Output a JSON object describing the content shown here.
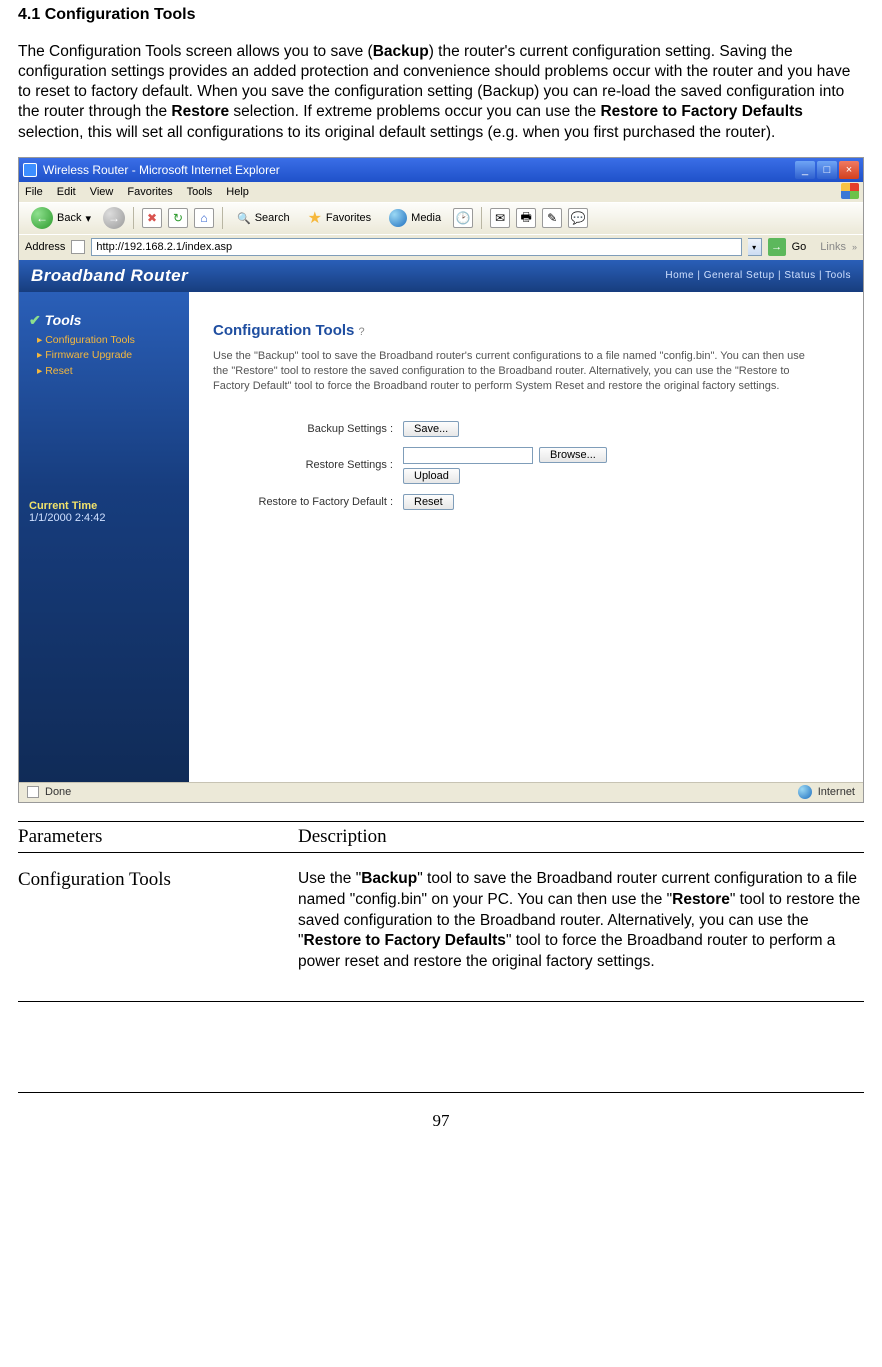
{
  "doc": {
    "section_heading": "4.1 Configuration Tools",
    "intro_pre_backup": "The Configuration Tools screen allows you to save (",
    "intro_backup": "Backup",
    "intro_post_backup": ") the router's current configuration setting. Saving the configuration settings provides an added protection and convenience should problems occur with the router and you have to reset to factory default. When you save the configuration setting (Backup) you can re-load the saved configuration into the router through the ",
    "intro_restore": "Restore",
    "intro_post_restore": " selection. If extreme problems occur you can use the ",
    "intro_r2fd": "Restore to Factory Defaults",
    "intro_post_r2fd": " selection, this will set all configurations to its original default settings (e.g. when you first purchased the router).",
    "page_number": "97"
  },
  "window": {
    "title": "Wireless Router - Microsoft Internet Explorer",
    "menu": {
      "file": "File",
      "edit": "Edit",
      "view": "View",
      "favorites": "Favorites",
      "tools": "Tools",
      "help": "Help"
    },
    "toolbar": {
      "back": "Back",
      "search": "Search",
      "favorites": "Favorites",
      "media": "Media"
    },
    "address_label": "Address",
    "address_value": "http://192.168.2.1/index.asp",
    "go": "Go",
    "links": "Links",
    "status_done": "Done",
    "status_zone": "Internet"
  },
  "router": {
    "brand": "Broadband Router",
    "nav_right": "Home | General Setup | Status | Tools",
    "sidebar": {
      "section": "Tools",
      "items": [
        "Configuration Tools",
        "Firmware Upgrade",
        "Reset"
      ],
      "current_time_label": "Current Time",
      "current_time_value": "1/1/2000 2:4:42"
    },
    "panel": {
      "title": "Configuration Tools",
      "help": "?",
      "desc": "Use the \"Backup\" tool to save the Broadband router's current configurations to a file named \"config.bin\". You can then use the \"Restore\" tool to restore the saved configuration to the Broadband router. Alternatively, you can use the \"Restore to Factory Default\" tool to force the Broadband router to perform System Reset and restore the original factory settings.",
      "rows": {
        "backup_label": "Backup Settings :",
        "backup_button": "Save...",
        "restore_label": "Restore Settings :",
        "restore_file": "",
        "restore_browse": "Browse...",
        "restore_upload": "Upload",
        "factory_label": "Restore to Factory Default :",
        "factory_button": "Reset"
      }
    }
  },
  "param": {
    "col1": "Parameters",
    "col2": "Description",
    "row_name": "Configuration Tools",
    "desc_1a": "Use the \"",
    "desc_1b": "Backup",
    "desc_1c": "\" tool to save the Broadband router current configuration to a file named \"config.bin\" on your PC. You can then use the \"",
    "desc_2b": "Restore",
    "desc_2c": "\" tool to restore the saved configuration to the Broadband router. Alternatively, you can use the \"",
    "desc_3b": "Restore to Factory Defaults",
    "desc_3c": "\" tool to force the Broadband router to perform a power reset and restore the original factory settings."
  }
}
